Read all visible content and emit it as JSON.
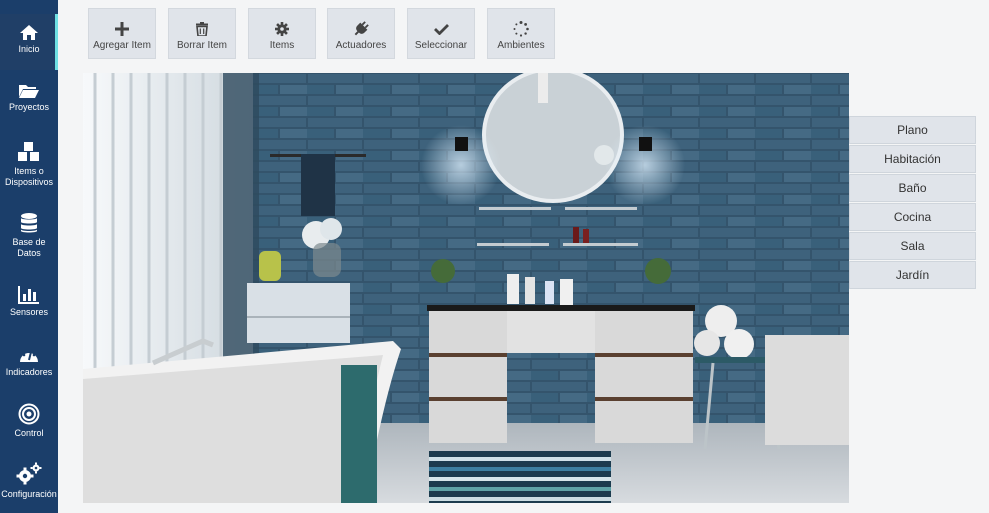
{
  "sidebar": {
    "items": [
      {
        "label": "Inicio",
        "icon": "home-icon"
      },
      {
        "label": "Proyectos",
        "icon": "folder-open-icon"
      },
      {
        "label": "Items o\nDispositivos",
        "icon": "cubes-icon"
      },
      {
        "label": "Base de\nDatos",
        "icon": "database-icon"
      },
      {
        "label": "Sensores",
        "icon": "bar-chart-icon"
      },
      {
        "label": "Indicadores",
        "icon": "dashboard-icon"
      },
      {
        "label": "Control",
        "icon": "target-icon"
      },
      {
        "label": "Configuración",
        "icon": "cogs-icon"
      }
    ]
  },
  "toolbar": {
    "buttons": [
      {
        "label": "Agregar Item",
        "icon": "plus-icon"
      },
      {
        "label": "Borrar Item",
        "icon": "trash-icon"
      },
      {
        "label": "Items",
        "icon": "gear-icon"
      },
      {
        "label": "Actuadores",
        "icon": "plug-icon"
      },
      {
        "label": "Seleccionar",
        "icon": "check-icon"
      },
      {
        "label": "Ambientes",
        "icon": "spinner-icon"
      }
    ]
  },
  "rooms": {
    "items": [
      "Plano",
      "Habitación",
      "Baño",
      "Cocina",
      "Sala",
      "Jardín"
    ]
  },
  "colors": {
    "sidebar_bg": "#1b3e6a",
    "active_indicator": "#6fe0e3",
    "button_bg": "#e0e4ea"
  }
}
